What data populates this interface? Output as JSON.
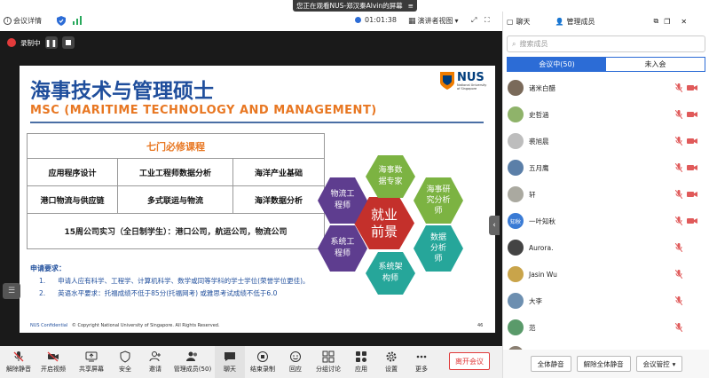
{
  "banner": {
    "text": "您正在观看NUS-郑汉秦Alvin的屏幕"
  },
  "titlebar": {
    "meeting_info": "会议详情",
    "timer": "01:01:38",
    "view_mode": "演讲者视图"
  },
  "recording": {
    "label": "录制中"
  },
  "slide": {
    "title_cn": "海事技术与管理硕士",
    "title_en": "MSC (MARITIME TECHNOLOGY AND MANAGEMENT)",
    "logo": {
      "text": "NUS",
      "sub1": "National University",
      "sub2": "of Singapore"
    },
    "table": {
      "header": "七门必修课程",
      "rows": [
        [
          "应用程序设计",
          "工业工程师数据分析",
          "海洋产业基础"
        ],
        [
          "港口物流与供应链",
          "多式联运与物流",
          "海洋数据分析"
        ]
      ],
      "last": "15周公司实习（全日制学生）：港口公司，航运公司，物流公司"
    },
    "requirements": {
      "heading": "申请要求：",
      "items": [
        {
          "num": "1.",
          "text": "申请人应有科学、工程学、计算机科学、数学或同等学科的学士学位(荣誉学位更佳)。"
        },
        {
          "num": "2.",
          "text": "英语水平要求：托福成绩不低于85分(托福网考) 或雅思考试成绩不低于6.0"
        }
      ]
    },
    "hexagons": {
      "center": "就业\n前景",
      "top": "海事数\n据专家",
      "top_right": "海事研\n究分析\n师",
      "bottom_right": "数据\n分析\n师",
      "bottom": "系统架\n构师",
      "bottom_left": "系统工\n程师",
      "top_left": "物流工\n程师"
    },
    "copyright": "© Copyright National University of Singapore. All Rights Reserved.",
    "watermark": "NUS Confidential",
    "page_no": "46"
  },
  "toolbar": {
    "items": [
      "解除静音",
      "开启视频",
      "共享屏幕",
      "安全",
      "邀请",
      "管理成员(50)",
      "聊天",
      "结束录制",
      "回应",
      "分组讨论",
      "应用",
      "设置",
      "更多"
    ],
    "leave": "离开会议"
  },
  "panel": {
    "chat_tab": "聊天",
    "members_tab": "管理成员",
    "search_placeholder": "搜索成员",
    "tab_in_meeting": "会议中(50)",
    "tab_not_joined": "未入会",
    "members": [
      {
        "name": "诸米白醋",
        "avatar": "#7a6a5a"
      },
      {
        "name": "史哲涵",
        "avatar": "#8fb36a"
      },
      {
        "name": "裘旭晨",
        "avatar": "#bdbdbd"
      },
      {
        "name": "五月鹰",
        "avatar": "#5b7fa8"
      },
      {
        "name": "轩",
        "avatar": "#aaa9a0"
      },
      {
        "name": "一叶知秋",
        "avatar": "#3a7bd5",
        "initials": "知秋"
      },
      {
        "name": "Aurora.",
        "avatar": "#444"
      },
      {
        "name": "Jasin Wu",
        "avatar": "#c9a44a"
      },
      {
        "name": "大李",
        "avatar": "#6d8fb0"
      },
      {
        "name": "范",
        "avatar": "#5a9a6a"
      },
      {
        "name": "刘曦",
        "avatar": "#8a7f72"
      }
    ],
    "footer": {
      "mute_all": "全体静音",
      "unmute_all": "解除全体静音",
      "control": "会议管控"
    }
  }
}
